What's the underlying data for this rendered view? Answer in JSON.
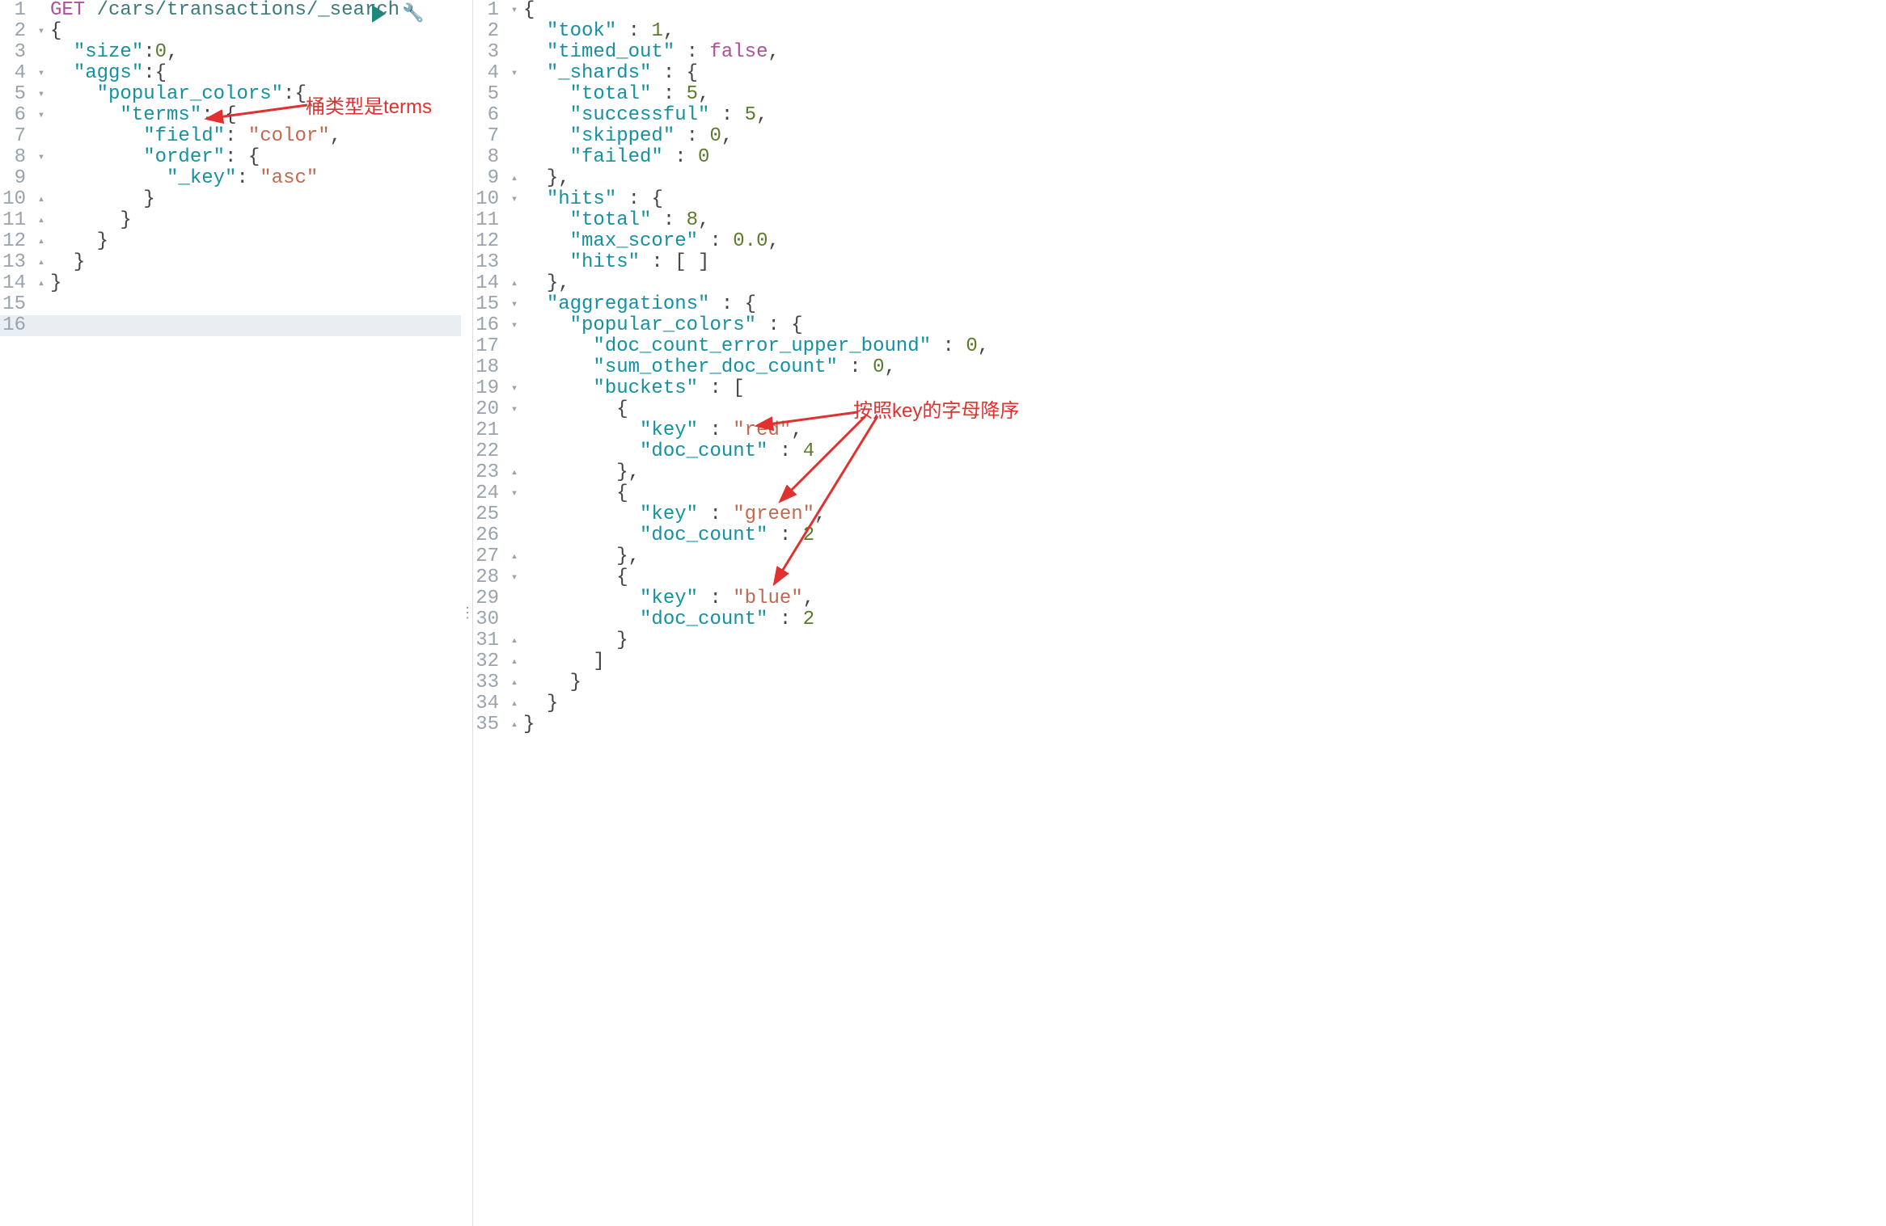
{
  "annotations": {
    "left": "桶类型是terms",
    "right": "按照key的字母降序"
  },
  "left": {
    "lines": [
      {
        "n": 1,
        "f": " ",
        "t": [
          [
            "method",
            "GET"
          ],
          [
            "plain",
            " "
          ],
          [
            "path",
            "/cars/transactions/_search"
          ]
        ]
      },
      {
        "n": 2,
        "f": "▾",
        "t": [
          [
            "punc",
            "{"
          ]
        ]
      },
      {
        "n": 3,
        "f": " ",
        "t": [
          [
            "plain",
            "  "
          ],
          [
            "key",
            "\"size\""
          ],
          [
            "punc",
            ":"
          ],
          [
            "num",
            "0"
          ],
          [
            "punc",
            ","
          ]
        ]
      },
      {
        "n": 4,
        "f": "▾",
        "t": [
          [
            "plain",
            "  "
          ],
          [
            "key",
            "\"aggs\""
          ],
          [
            "punc",
            ":"
          ],
          [
            "punc",
            "{"
          ]
        ]
      },
      {
        "n": 5,
        "f": "▾",
        "t": [
          [
            "plain",
            "    "
          ],
          [
            "key",
            "\"popular_colors\""
          ],
          [
            "punc",
            ":"
          ],
          [
            "punc",
            "{"
          ]
        ]
      },
      {
        "n": 6,
        "f": "▾",
        "t": [
          [
            "plain",
            "      "
          ],
          [
            "key",
            "\"terms\""
          ],
          [
            "punc",
            ": "
          ],
          [
            "punc",
            "{"
          ]
        ]
      },
      {
        "n": 7,
        "f": " ",
        "t": [
          [
            "plain",
            "        "
          ],
          [
            "key",
            "\"field\""
          ],
          [
            "punc",
            ": "
          ],
          [
            "str",
            "\"color\""
          ],
          [
            "punc",
            ","
          ]
        ]
      },
      {
        "n": 8,
        "f": "▾",
        "t": [
          [
            "plain",
            "        "
          ],
          [
            "key",
            "\"order\""
          ],
          [
            "punc",
            ": "
          ],
          [
            "punc",
            "{"
          ]
        ]
      },
      {
        "n": 9,
        "f": " ",
        "t": [
          [
            "plain",
            "          "
          ],
          [
            "key",
            "\"_key\""
          ],
          [
            "punc",
            ": "
          ],
          [
            "str",
            "\"asc\""
          ]
        ]
      },
      {
        "n": 10,
        "f": "▴",
        "t": [
          [
            "plain",
            "        "
          ],
          [
            "punc",
            "}"
          ]
        ]
      },
      {
        "n": 11,
        "f": "▴",
        "t": [
          [
            "plain",
            "      "
          ],
          [
            "punc",
            "}"
          ]
        ]
      },
      {
        "n": 12,
        "f": "▴",
        "t": [
          [
            "plain",
            "    "
          ],
          [
            "punc",
            "}"
          ]
        ]
      },
      {
        "n": 13,
        "f": "▴",
        "t": [
          [
            "plain",
            "  "
          ],
          [
            "punc",
            "}"
          ]
        ]
      },
      {
        "n": 14,
        "f": "▴",
        "t": [
          [
            "punc",
            "}"
          ]
        ]
      },
      {
        "n": 15,
        "f": " ",
        "t": []
      },
      {
        "n": 16,
        "f": " ",
        "t": [],
        "current": true
      }
    ]
  },
  "right": {
    "lines": [
      {
        "n": 1,
        "f": "▾",
        "t": [
          [
            "punc",
            "{"
          ]
        ]
      },
      {
        "n": 2,
        "f": " ",
        "t": [
          [
            "plain",
            "  "
          ],
          [
            "key",
            "\"took\""
          ],
          [
            "punc",
            " : "
          ],
          [
            "num",
            "1"
          ],
          [
            "punc",
            ","
          ]
        ]
      },
      {
        "n": 3,
        "f": " ",
        "t": [
          [
            "plain",
            "  "
          ],
          [
            "key",
            "\"timed_out\""
          ],
          [
            "punc",
            " : "
          ],
          [
            "bool",
            "false"
          ],
          [
            "punc",
            ","
          ]
        ]
      },
      {
        "n": 4,
        "f": "▾",
        "t": [
          [
            "plain",
            "  "
          ],
          [
            "key",
            "\"_shards\""
          ],
          [
            "punc",
            " : "
          ],
          [
            "punc",
            "{"
          ]
        ]
      },
      {
        "n": 5,
        "f": " ",
        "t": [
          [
            "plain",
            "    "
          ],
          [
            "key",
            "\"total\""
          ],
          [
            "punc",
            " : "
          ],
          [
            "num",
            "5"
          ],
          [
            "punc",
            ","
          ]
        ]
      },
      {
        "n": 6,
        "f": " ",
        "t": [
          [
            "plain",
            "    "
          ],
          [
            "key",
            "\"successful\""
          ],
          [
            "punc",
            " : "
          ],
          [
            "num",
            "5"
          ],
          [
            "punc",
            ","
          ]
        ]
      },
      {
        "n": 7,
        "f": " ",
        "t": [
          [
            "plain",
            "    "
          ],
          [
            "key",
            "\"skipped\""
          ],
          [
            "punc",
            " : "
          ],
          [
            "num",
            "0"
          ],
          [
            "punc",
            ","
          ]
        ]
      },
      {
        "n": 8,
        "f": " ",
        "t": [
          [
            "plain",
            "    "
          ],
          [
            "key",
            "\"failed\""
          ],
          [
            "punc",
            " : "
          ],
          [
            "num",
            "0"
          ]
        ]
      },
      {
        "n": 9,
        "f": "▴",
        "t": [
          [
            "plain",
            "  "
          ],
          [
            "punc",
            "},"
          ]
        ]
      },
      {
        "n": 10,
        "f": "▾",
        "t": [
          [
            "plain",
            "  "
          ],
          [
            "key",
            "\"hits\""
          ],
          [
            "punc",
            " : "
          ],
          [
            "punc",
            "{"
          ]
        ]
      },
      {
        "n": 11,
        "f": " ",
        "t": [
          [
            "plain",
            "    "
          ],
          [
            "key",
            "\"total\""
          ],
          [
            "punc",
            " : "
          ],
          [
            "num",
            "8"
          ],
          [
            "punc",
            ","
          ]
        ]
      },
      {
        "n": 12,
        "f": " ",
        "t": [
          [
            "plain",
            "    "
          ],
          [
            "key",
            "\"max_score\""
          ],
          [
            "punc",
            " : "
          ],
          [
            "num",
            "0.0"
          ],
          [
            "punc",
            ","
          ]
        ]
      },
      {
        "n": 13,
        "f": " ",
        "t": [
          [
            "plain",
            "    "
          ],
          [
            "key",
            "\"hits\""
          ],
          [
            "punc",
            " : [ ]"
          ]
        ]
      },
      {
        "n": 14,
        "f": "▴",
        "t": [
          [
            "plain",
            "  "
          ],
          [
            "punc",
            "},"
          ]
        ]
      },
      {
        "n": 15,
        "f": "▾",
        "t": [
          [
            "plain",
            "  "
          ],
          [
            "key",
            "\"aggregations\""
          ],
          [
            "punc",
            " : "
          ],
          [
            "punc",
            "{"
          ]
        ]
      },
      {
        "n": 16,
        "f": "▾",
        "t": [
          [
            "plain",
            "    "
          ],
          [
            "key",
            "\"popular_colors\""
          ],
          [
            "punc",
            " : "
          ],
          [
            "punc",
            "{"
          ]
        ]
      },
      {
        "n": 17,
        "f": " ",
        "t": [
          [
            "plain",
            "      "
          ],
          [
            "key",
            "\"doc_count_error_upper_bound\""
          ],
          [
            "punc",
            " : "
          ],
          [
            "num",
            "0"
          ],
          [
            "punc",
            ","
          ]
        ]
      },
      {
        "n": 18,
        "f": " ",
        "t": [
          [
            "plain",
            "      "
          ],
          [
            "key",
            "\"sum_other_doc_count\""
          ],
          [
            "punc",
            " : "
          ],
          [
            "num",
            "0"
          ],
          [
            "punc",
            ","
          ]
        ]
      },
      {
        "n": 19,
        "f": "▾",
        "t": [
          [
            "plain",
            "      "
          ],
          [
            "key",
            "\"buckets\""
          ],
          [
            "punc",
            " : ["
          ]
        ]
      },
      {
        "n": 20,
        "f": "▾",
        "t": [
          [
            "plain",
            "        "
          ],
          [
            "punc",
            "{"
          ]
        ]
      },
      {
        "n": 21,
        "f": " ",
        "t": [
          [
            "plain",
            "          "
          ],
          [
            "key",
            "\"key\""
          ],
          [
            "punc",
            " : "
          ],
          [
            "str",
            "\"red\""
          ],
          [
            "punc",
            ","
          ]
        ]
      },
      {
        "n": 22,
        "f": " ",
        "t": [
          [
            "plain",
            "          "
          ],
          [
            "key",
            "\"doc_count\""
          ],
          [
            "punc",
            " : "
          ],
          [
            "num",
            "4"
          ]
        ]
      },
      {
        "n": 23,
        "f": "▴",
        "t": [
          [
            "plain",
            "        "
          ],
          [
            "punc",
            "},"
          ]
        ]
      },
      {
        "n": 24,
        "f": "▾",
        "t": [
          [
            "plain",
            "        "
          ],
          [
            "punc",
            "{"
          ]
        ]
      },
      {
        "n": 25,
        "f": " ",
        "t": [
          [
            "plain",
            "          "
          ],
          [
            "key",
            "\"key\""
          ],
          [
            "punc",
            " : "
          ],
          [
            "str",
            "\"green\""
          ],
          [
            "punc",
            ","
          ]
        ]
      },
      {
        "n": 26,
        "f": " ",
        "t": [
          [
            "plain",
            "          "
          ],
          [
            "key",
            "\"doc_count\""
          ],
          [
            "punc",
            " : "
          ],
          [
            "num",
            "2"
          ]
        ]
      },
      {
        "n": 27,
        "f": "▴",
        "t": [
          [
            "plain",
            "        "
          ],
          [
            "punc",
            "},"
          ]
        ]
      },
      {
        "n": 28,
        "f": "▾",
        "t": [
          [
            "plain",
            "        "
          ],
          [
            "punc",
            "{"
          ]
        ]
      },
      {
        "n": 29,
        "f": " ",
        "t": [
          [
            "plain",
            "          "
          ],
          [
            "key",
            "\"key\""
          ],
          [
            "punc",
            " : "
          ],
          [
            "str",
            "\"blue\""
          ],
          [
            "punc",
            ","
          ]
        ]
      },
      {
        "n": 30,
        "f": " ",
        "t": [
          [
            "plain",
            "          "
          ],
          [
            "key",
            "\"doc_count\""
          ],
          [
            "punc",
            " : "
          ],
          [
            "num",
            "2"
          ]
        ]
      },
      {
        "n": 31,
        "f": "▴",
        "t": [
          [
            "plain",
            "        "
          ],
          [
            "punc",
            "}"
          ]
        ]
      },
      {
        "n": 32,
        "f": "▴",
        "t": [
          [
            "plain",
            "      "
          ],
          [
            "punc",
            "]"
          ]
        ]
      },
      {
        "n": 33,
        "f": "▴",
        "t": [
          [
            "plain",
            "    "
          ],
          [
            "punc",
            "}"
          ]
        ]
      },
      {
        "n": 34,
        "f": "▴",
        "t": [
          [
            "plain",
            "  "
          ],
          [
            "punc",
            "}"
          ]
        ]
      },
      {
        "n": 35,
        "f": "▴",
        "t": [
          [
            "punc",
            "}"
          ]
        ]
      }
    ]
  }
}
